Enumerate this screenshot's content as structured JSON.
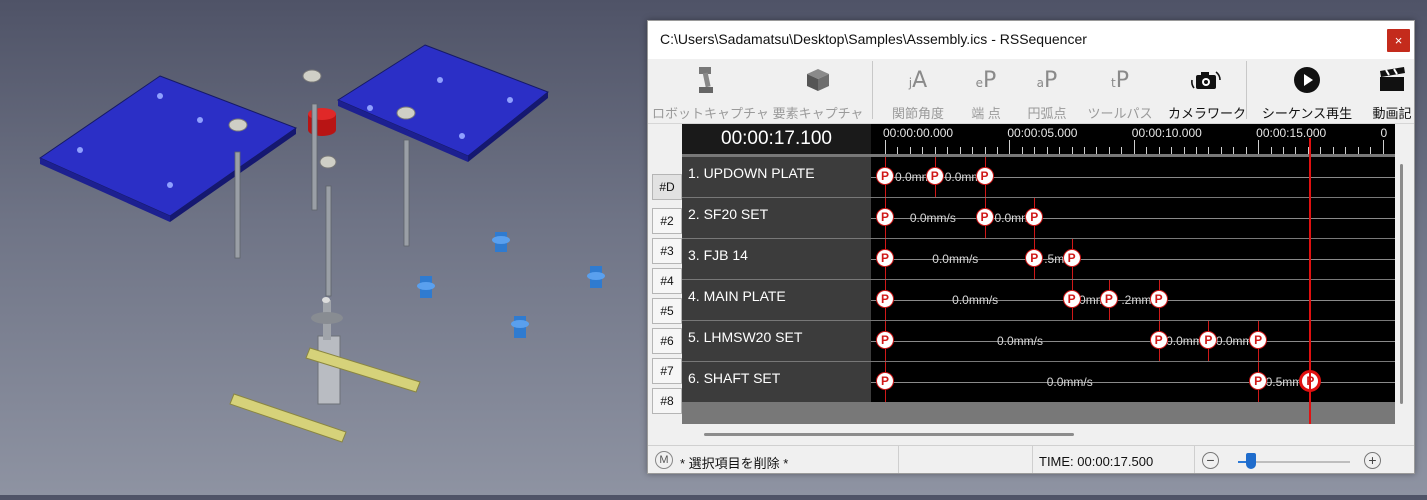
{
  "window": {
    "title": "C:\\Users\\Sadamatsu\\Desktop\\Samples\\Assembly.ics - RSSequencer",
    "close_label": "×"
  },
  "toolbar": {
    "buttons": [
      {
        "label": "ロボットキャプチャ",
        "icon": "robot-capture-icon",
        "enabled": false
      },
      {
        "label": "要素キャプチャ",
        "icon": "element-capture-icon",
        "enabled": false
      },
      {
        "label": "関節角度",
        "icon": "joint-angle-icon",
        "glyph": "jA",
        "enabled": false
      },
      {
        "label": "端 点",
        "icon": "endpoint-icon",
        "glyph": "eP",
        "enabled": false
      },
      {
        "label": "円弧点",
        "icon": "arc-point-icon",
        "glyph": "aP",
        "enabled": false
      },
      {
        "label": "ツールパス",
        "icon": "tool-path-icon",
        "glyph": "tP",
        "enabled": false
      },
      {
        "label": "カメラワーク",
        "icon": "camera-work-icon",
        "enabled": true
      },
      {
        "label": "シーケンス再生",
        "icon": "play-icon",
        "enabled": true
      },
      {
        "label": "動画記",
        "icon": "video-record-icon",
        "enabled": true
      }
    ]
  },
  "sequence": {
    "current_time": "00:00:17.100",
    "ruler_labels": [
      "00:00:00.000",
      "00:00:05.000",
      "00:00:10.000",
      "00:00:15.000",
      "0"
    ],
    "ruler_max_seconds": 20.5,
    "cursor_seconds": 17.1,
    "tabs": [
      "#D",
      "#2",
      "#3",
      "#4",
      "#5",
      "#6",
      "#7",
      "#8"
    ],
    "active_tab": 0,
    "rows": [
      {
        "name": "1.  UPDOWN PLATE",
        "keys": [
          0.0,
          2.0,
          4.0
        ],
        "speeds": [
          {
            "text": "0.0mm",
            "at": 0.4
          },
          {
            "text": "0.0mm",
            "at": 2.4
          }
        ]
      },
      {
        "name": "2.  SF20 SET",
        "keys": [
          0.0,
          4.0,
          6.0
        ],
        "speeds": [
          {
            "text": "0.0mm/s",
            "at": 1.0
          },
          {
            "text": "0.0mm",
            "at": 4.4
          }
        ]
      },
      {
        "name": "3.  FJB 14",
        "keys": [
          0.0,
          6.0,
          7.5
        ],
        "speeds": [
          {
            "text": "0.0mm/s",
            "at": 1.9
          },
          {
            "text": ".5mm",
            "at": 6.4
          }
        ]
      },
      {
        "name": "4.  MAIN PLATE",
        "keys": [
          0.0,
          7.5,
          9.0,
          11.0
        ],
        "speeds": [
          {
            "text": "0.0mm/s",
            "at": 2.7
          },
          {
            "text": "0mm",
            "at": 7.8
          },
          {
            "text": ".2mm",
            "at": 9.5
          }
        ]
      },
      {
        "name": "5.  LHMSW20 SET",
        "keys": [
          0.0,
          11.0,
          13.0,
          15.0
        ],
        "speeds": [
          {
            "text": "0.0mm/s",
            "at": 4.5
          },
          {
            "text": "0.0mm",
            "at": 11.3
          },
          {
            "text": "0.0mm",
            "at": 13.3
          }
        ]
      },
      {
        "name": "6.  SHAFT SET",
        "keys": [
          0.0,
          15.0,
          17.1
        ],
        "speeds": [
          {
            "text": "0.0mm/s",
            "at": 6.5
          },
          {
            "text": "0.5mm",
            "at": 15.3
          }
        ]
      }
    ]
  },
  "status": {
    "m_label": "M",
    "message": "* 選択項目を削除 *",
    "time": "TIME: 00:00:17.500",
    "zoom_minus": "−",
    "zoom_plus": "+",
    "zoom_level": 0.12
  },
  "colors": {
    "key_red": "#d01818",
    "plate_blue": "#2b2fc6",
    "cap_red": "#d41a1a",
    "fitting_blue": "#2f7bd0",
    "bar_yellow": "#d6d27a"
  }
}
